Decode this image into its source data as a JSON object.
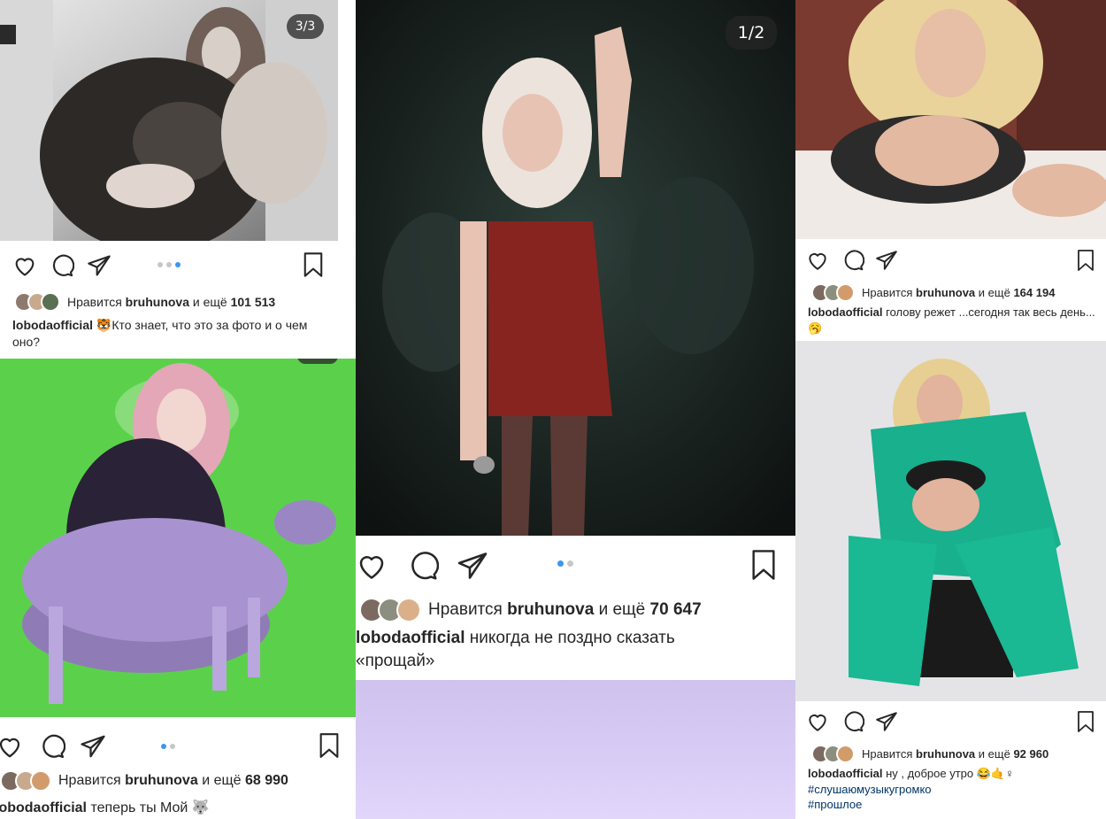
{
  "colors": {
    "accent": "#3897f0",
    "text": "#262626",
    "hashtag": "#003569",
    "green_screen": "#5bd14b",
    "lavender": "#d9cdf6"
  },
  "posts": [
    {
      "id": "post-top-left",
      "counter": "3/3",
      "likes_prefix": "Нравится",
      "liked_by": "bruhunova",
      "likes_mid": "и ещё",
      "likes_count": "101 513",
      "username": "lobodaofficial",
      "emoji": "🐯",
      "caption": "Кто знает, что это за фото и о чем оно?",
      "carousel_active": 2,
      "icons": [
        "heart-icon",
        "comment-icon",
        "share-icon",
        "bookmark-icon"
      ]
    },
    {
      "id": "post-center",
      "counter": "1/2",
      "likes_prefix": "Нравится",
      "liked_by": "bruhunova",
      "likes_mid": "и ещё",
      "likes_count": "70 647",
      "username": "lobodaofficial",
      "caption": "никогда не поздно сказать «прощай»",
      "carousel_active": 0,
      "icons": [
        "heart-icon",
        "comment-icon",
        "share-icon",
        "bookmark-icon"
      ]
    },
    {
      "id": "post-top-right",
      "likes_prefix": "Нравится",
      "liked_by": "bruhunova",
      "likes_mid": "и ещё",
      "likes_count": "164 194",
      "username": "lobodaofficial",
      "caption": "голову режет ...сегодня так весь день...",
      "emoji": "🥱",
      "icons": [
        "heart-icon",
        "comment-icon",
        "share-icon",
        "bookmark-icon"
      ]
    },
    {
      "id": "post-bottom-left",
      "likes_prefix": "Нравится",
      "liked_by": "bruhunova",
      "likes_mid": "и ещё",
      "likes_count": "68 990",
      "username": "lobodaofficial",
      "caption": "теперь ты Мой",
      "emoji": "🐺",
      "carousel_active": 0,
      "icons": [
        "heart-icon",
        "comment-icon",
        "share-icon",
        "bookmark-icon"
      ]
    },
    {
      "id": "post-bottom-right",
      "likes_prefix": "Нравится",
      "liked_by": "bruhunova",
      "likes_mid": "и ещё",
      "likes_count": "92 960",
      "username": "lobodaofficial",
      "caption": "ну , доброе утро",
      "emoji": "😂🤙♀",
      "hashtags": [
        "#слушаюмузыкугромко",
        "#прошлое"
      ],
      "icons": [
        "heart-icon",
        "comment-icon",
        "share-icon",
        "bookmark-icon"
      ]
    }
  ]
}
